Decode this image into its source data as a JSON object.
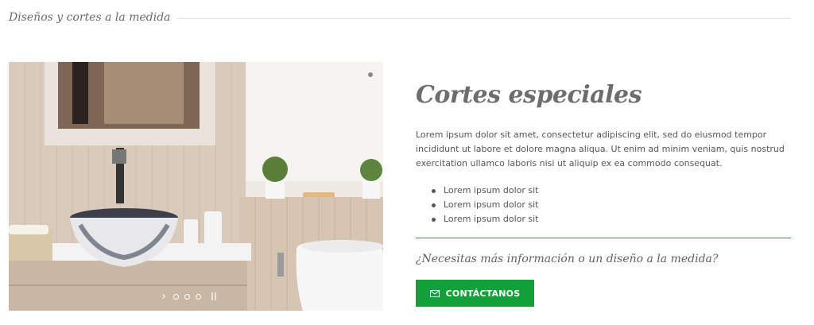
{
  "section": {
    "title": "Diseños y cortes a la medida"
  },
  "slider": {
    "next_glyph": "›",
    "dots": [
      {
        "active": false
      },
      {
        "active": false
      },
      {
        "active": false
      }
    ]
  },
  "content": {
    "title": "Cortes especiales",
    "body": "Lorem ipsum dolor sit amet, consectetur adipiscing elit, sed do eiusmod tempor incididunt ut labore et dolore magna aliqua. Ut enim ad minim veniam, quis nostrud exercitation ullamco laboris nisi ut aliquip ex ea commodo consequat.",
    "bullets": [
      "Lorem ipsum dolor sit",
      "Lorem ipsum dolor sit",
      "Lorem ipsum dolor sit"
    ],
    "question": "¿Necesitas más información o un diseño a la medida?",
    "button_label": "CONTÁCTANOS",
    "button_icon": "mail-icon"
  },
  "colors": {
    "accent_green": "#11a03a",
    "rule_green": "#1f9a48"
  }
}
